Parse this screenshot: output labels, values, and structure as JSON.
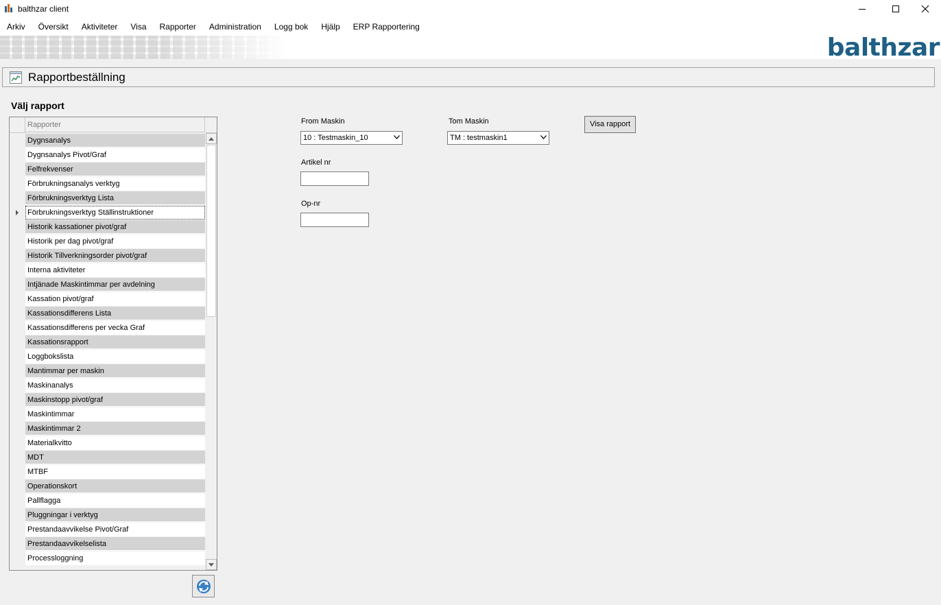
{
  "window": {
    "title": "balthzar client",
    "minimize_icon": "minimize-icon",
    "maximize_icon": "maximize-icon",
    "close_icon": "close-icon"
  },
  "menu": [
    "Arkiv",
    "Översikt",
    "Aktiviteter",
    "Visa",
    "Rapporter",
    "Administration",
    "Logg bok",
    "Hjälp",
    "ERP Rapportering"
  ],
  "banner": {
    "brand": "balthzar",
    "brand_color": "#1e5f86"
  },
  "header": {
    "title": "Rapportbeställning",
    "icon": "report-chart-icon"
  },
  "report_list": {
    "section_label": "Välj rapport",
    "column_header": "Rapporter",
    "current_index": 5,
    "items": [
      "Dygnsanalys",
      "Dygnsanalys Pivot/Graf",
      "Felfrekvenser",
      "Förbrukningsanalys verktyg",
      "Förbrukningsverktyg Lista",
      "Förbrukningsverktyg Ställinstruktioner",
      "Historik kassationer pivot/graf",
      "Historik per dag pivot/graf",
      "Historik Tillverkningsorder pivot/graf",
      "Interna aktiviteter",
      "Intjänade Maskintimmar per avdelning",
      "Kassation pivot/graf",
      "Kassationsdifferens Lista",
      "Kassationsdifferens per vecka Graf",
      "Kassationsrapport",
      "Loggbokslista",
      "Mantimmar per maskin",
      "Maskinanalys",
      "Maskinstopp pivot/graf",
      "Maskintimmar",
      "Maskintimmar 2",
      "Materialkvitto",
      "MDT",
      "MTBF",
      "Operationskort",
      "Pallflagga",
      "Pluggningar i verktyg",
      "Prestandaavvikelse Pivot/Graf",
      "Prestandaavvikelselista",
      "Processloggning"
    ],
    "refresh_icon": "refresh-icon"
  },
  "form": {
    "from_maskin": {
      "label": "From Maskin",
      "value": "10 : Testmaskin_10"
    },
    "tom_maskin": {
      "label": "Tom Maskin",
      "value": "TM : testmaskin1"
    },
    "artikel_nr": {
      "label": "Artikel nr",
      "value": ""
    },
    "op_nr": {
      "label": "Op-nr",
      "value": ""
    },
    "show_button": "Visa rapport"
  }
}
